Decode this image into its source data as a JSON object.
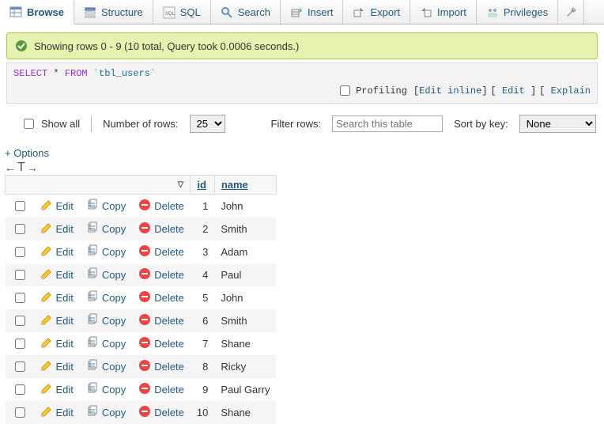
{
  "tabs": {
    "browse": "Browse",
    "structure": "Structure",
    "sql": "SQL",
    "search": "Search",
    "insert": "Insert",
    "export": "Export",
    "import": "Import",
    "privileges": "Privileges"
  },
  "banner": {
    "text": "Showing rows 0 - 9 (10 total, Query took 0.0006 seconds.)"
  },
  "sql": {
    "select": "SELECT",
    "star": "*",
    "from": "FROM",
    "table": "`tbl_users`"
  },
  "inline": {
    "profiling": "Profiling",
    "edit_inline": "Edit inline",
    "edit": "Edit",
    "explain": "Explain"
  },
  "controls": {
    "showall": "Show all",
    "numrows": "Number of rows:",
    "numrows_value": "25",
    "filter_label": "Filter rows:",
    "filter_placeholder": "Search this table",
    "sort_label": "Sort by key:",
    "sort_value": "None"
  },
  "options_link": "+ Options",
  "headers": {
    "id": "id",
    "name": "name"
  },
  "action_labels": {
    "edit": "Edit",
    "copy": "Copy",
    "delete": "Delete"
  },
  "rows": [
    {
      "id": "1",
      "name": "John"
    },
    {
      "id": "2",
      "name": "Smith"
    },
    {
      "id": "3",
      "name": "Adam"
    },
    {
      "id": "4",
      "name": "Paul"
    },
    {
      "id": "5",
      "name": "John"
    },
    {
      "id": "6",
      "name": "Smith"
    },
    {
      "id": "7",
      "name": "Shane"
    },
    {
      "id": "8",
      "name": "Ricky"
    },
    {
      "id": "9",
      "name": "Paul Garry"
    },
    {
      "id": "10",
      "name": "Shane"
    }
  ]
}
